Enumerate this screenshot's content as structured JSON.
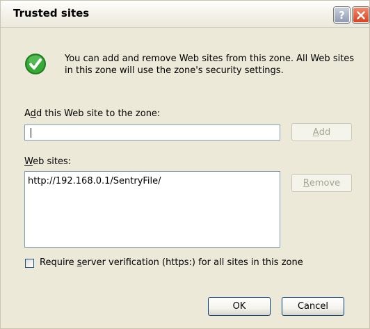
{
  "dialog": {
    "title": "Trusted sites",
    "help_glyph": "?",
    "info_text_line1": "You can add and remove Web sites from this zone. All Web sites",
    "info_text_line2": "in this zone will use the zone's security settings.",
    "add_label_prefix": "A",
    "add_label_mnemonic": "d",
    "add_label_rest": "d this Web site to the zone:",
    "add_input_value": "",
    "add_button": {
      "mnemonic": "A",
      "rest": "dd",
      "enabled": false
    },
    "websites_label_mnemonic": "W",
    "websites_label_rest": "eb sites:",
    "websites": [
      "http://192.168.0.1/SentryFile/"
    ],
    "remove_button": {
      "mnemonic": "R",
      "rest": "emove",
      "enabled": false
    },
    "require_checkbox": {
      "checked": false,
      "label_prefix": "Require ",
      "label_mnemonic": "s",
      "label_rest": "erver verification (https:) for all sites in this zone"
    },
    "ok_label": "OK",
    "cancel_label": "Cancel"
  },
  "icons": {
    "info": "green-checkmark-icon",
    "help": "help-icon",
    "close": "close-icon"
  },
  "colors": {
    "dialog_bg": "#ece9d8",
    "close_red": "#d8421e",
    "check_green": "#2a9a2a"
  }
}
